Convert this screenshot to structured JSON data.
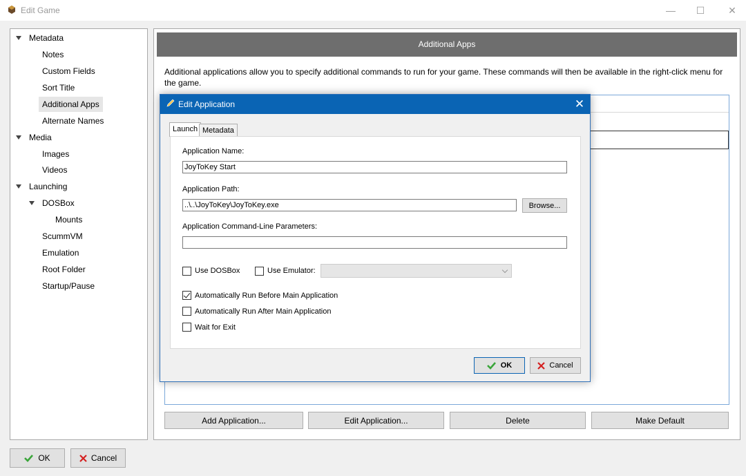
{
  "window": {
    "title": "Edit Game",
    "minimize": "—",
    "maximize": "☐",
    "close": "✕"
  },
  "tree": [
    {
      "label": "Metadata",
      "expander": true
    },
    {
      "label": "Notes"
    },
    {
      "label": "Custom Fields"
    },
    {
      "label": "Sort Title"
    },
    {
      "label": "Additional Apps",
      "selected": true
    },
    {
      "label": "Alternate Names"
    },
    {
      "label": "Media",
      "expander": true
    },
    {
      "label": "Images"
    },
    {
      "label": "Videos"
    },
    {
      "label": "Launching",
      "expander": true
    },
    {
      "label": "DOSBox",
      "expander": true
    },
    {
      "label": "Mounts"
    },
    {
      "label": "ScummVM"
    },
    {
      "label": "Emulation"
    },
    {
      "label": "Root Folder"
    },
    {
      "label": "Startup/Pause"
    }
  ],
  "panel": {
    "header": "Additional Apps",
    "description": "Additional applications allow you to specify additional commands to run for your game.  These commands will then be available in the right-click menu for the game.",
    "buttons": {
      "add": "Add Application...",
      "edit": "Edit Application...",
      "delete": "Delete",
      "make_default": "Make Default"
    }
  },
  "footer": {
    "ok": "OK",
    "cancel": "Cancel"
  },
  "dialog": {
    "title": "Edit Application",
    "close": "✕",
    "tabs": {
      "launch": "Launch",
      "metadata": "Metadata"
    },
    "app_name_label": "Application Name:",
    "app_name_value": "JoyToKey Start",
    "app_path_label": "Application Path:",
    "app_path_value": "..\\..\\JoyToKey\\JoyToKey.exe",
    "browse": "Browse...",
    "params_label": "Application Command-Line Parameters:",
    "params_value": "",
    "use_dosbox": {
      "label": "Use DOSBox",
      "checked": false
    },
    "use_emulator": {
      "label": "Use Emulator:",
      "checked": false
    },
    "emulator_value": "",
    "run_before": {
      "label": "Automatically Run Before Main Application",
      "checked": true
    },
    "run_after": {
      "label": "Automatically Run After Main Application",
      "checked": false
    },
    "wait_exit": {
      "label": "Wait for Exit",
      "checked": false
    },
    "ok": "OK",
    "cancel": "Cancel"
  },
  "colors": {
    "accent": "#0a64b4",
    "panel_header": "#6e6e6e",
    "ok_check": "#3aa53a",
    "cancel_x": "#d42020"
  }
}
